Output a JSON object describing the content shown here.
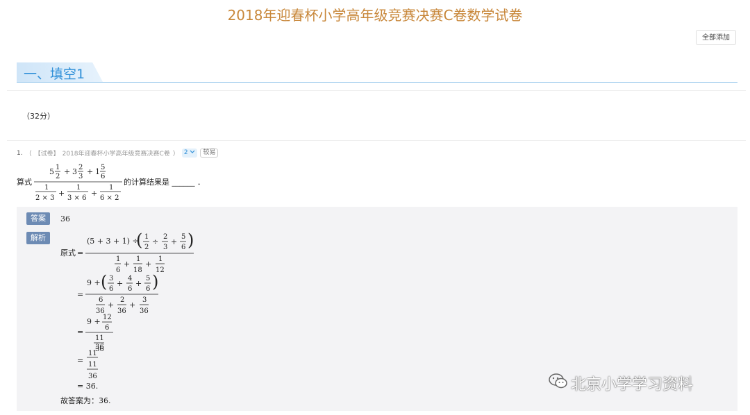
{
  "page_title": "2018年迎春杯小学高年级竞赛决赛C卷数学试卷",
  "toolbar": {
    "add_all_label": "全部添加"
  },
  "section": {
    "title": "一、填空1",
    "score": "（32分）"
  },
  "question": {
    "number": "1.",
    "source_open": "（",
    "source_tag": "【试卷】",
    "source": "2018年迎春杯小学高年级竞赛决赛C卷",
    "source_close": "）",
    "count_badge": "2",
    "difficulty": "较易",
    "prefix": "算式",
    "suffix": "的计算结果是 ______ ．",
    "numerator": {
      "a_whole": "5",
      "a_num": "1",
      "a_den": "2",
      "op1": "+",
      "b_whole": "3",
      "b_num": "2",
      "b_den": "3",
      "op2": "+",
      "c_whole": "1",
      "c_num": "5",
      "c_den": "6"
    },
    "denominator": {
      "d1": "2 × 3",
      "op1": "+",
      "d2": "3 × 6",
      "op2": "+",
      "d3": "6 × 2",
      "one": "1"
    }
  },
  "answer": {
    "label": "答案",
    "value": "36"
  },
  "analysis": {
    "label": "解析",
    "prefix": "原式",
    "line1_num_head": "(5 + 3 + 1) ÷",
    "line1_num_fracs": [
      {
        "n": "1",
        "d": "2"
      },
      {
        "n": "2",
        "d": "3"
      },
      {
        "n": "5",
        "d": "6"
      }
    ],
    "line1_num_ops": [
      "÷",
      "+"
    ],
    "line1_den_fracs": [
      {
        "n": "1",
        "d": "6"
      },
      {
        "n": "1",
        "d": "18"
      },
      {
        "n": "1",
        "d": "12"
      }
    ],
    "line1_den_ops": [
      "+",
      "+"
    ],
    "line2_num_head": "9 +",
    "line2_num_fracs": [
      {
        "n": "3",
        "d": "6"
      },
      {
        "n": "4",
        "d": "6"
      },
      {
        "n": "5",
        "d": "6"
      }
    ],
    "line2_num_ops": [
      "+",
      "+"
    ],
    "line2_den_fracs": [
      {
        "n": "6",
        "d": "36"
      },
      {
        "n": "2",
        "d": "36"
      },
      {
        "n": "3",
        "d": "36"
      }
    ],
    "line2_den_ops": [
      "+",
      "+"
    ],
    "line3_num_head": "9 +",
    "line3_num_frac": {
      "n": "12",
      "d": "6"
    },
    "line3_den_frac": {
      "n": "11",
      "d": "36"
    },
    "line4_num_frac": {
      "n": "11",
      "d": "36"
    },
    "line4_den": "11",
    "line4_den_small": "36",
    "line5": "= 36.",
    "conclusion": "故答案为：36."
  },
  "watermark": {
    "text": "北京小学学习资料",
    "icon": "wechat-icon"
  }
}
